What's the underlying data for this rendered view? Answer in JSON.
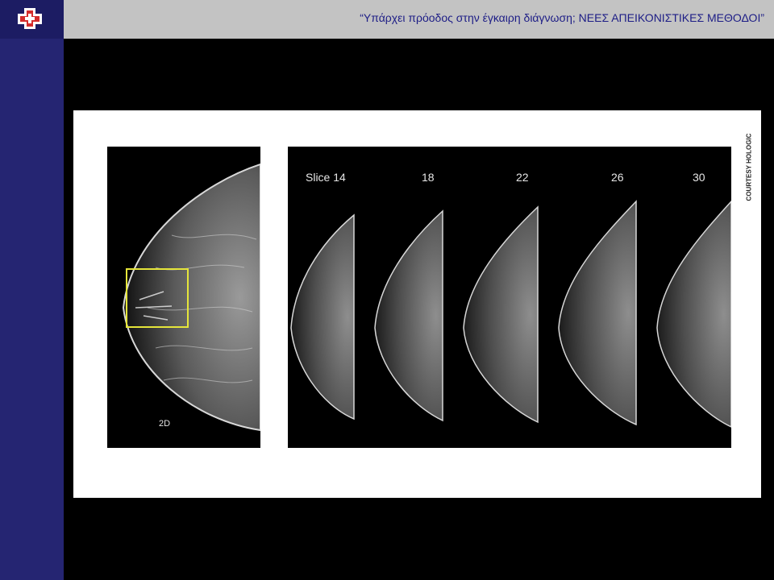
{
  "header": {
    "title": "“Υπάρχει πρόοδος στην έγκαιρη διάγνωση;  ΝΕΕΣ ΑΠΕΙΚΟΝΙΣΤΙΚΕΣ  ΜΕΘΟΔΟΙ”",
    "logo_icon": "medical-cross-logo-icon"
  },
  "figure": {
    "panel_2d_label": "2D",
    "slice_labels": [
      "Slice 14",
      "18",
      "22",
      "26",
      "30"
    ],
    "courtesy": "COURTESY HOLOGIC",
    "highlight_color": "#e5e53a"
  },
  "colors": {
    "header_bg": "#c3c3c3",
    "sidebar_bg": "#252572",
    "title_text": "#1d1d86"
  }
}
